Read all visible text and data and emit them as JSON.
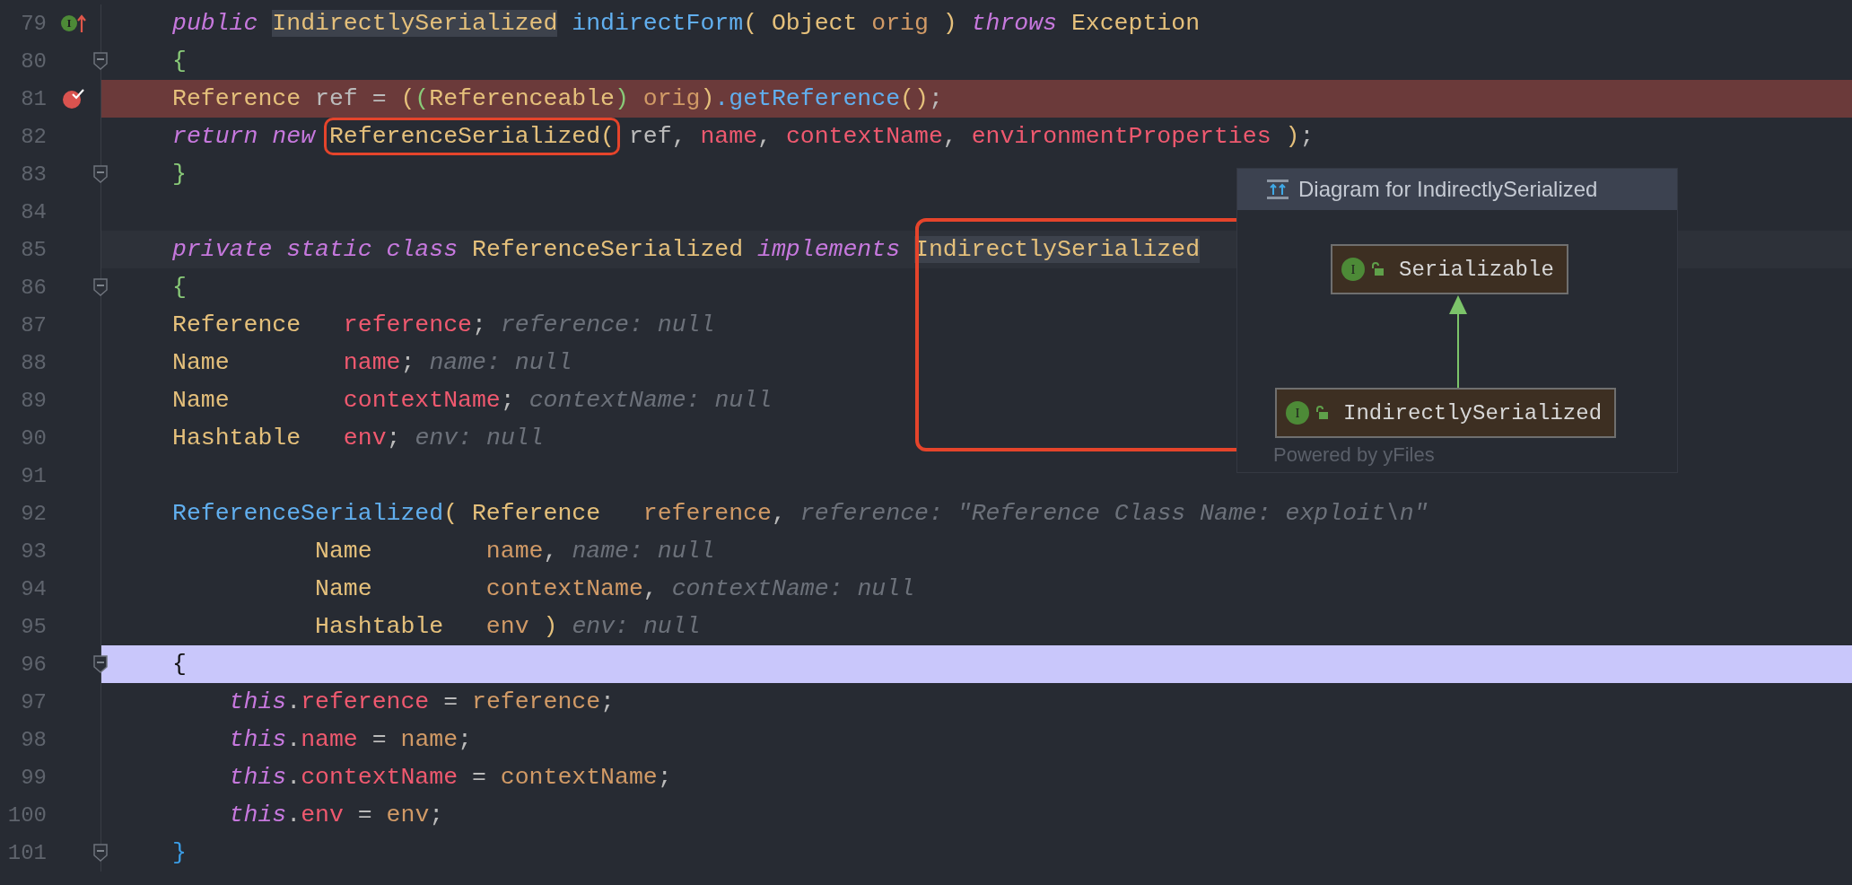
{
  "editor": {
    "lines": [
      {
        "number": "79",
        "gutter_icon": {
          "kind": "implemented",
          "letter": "I"
        },
        "fold": false,
        "kind": "normal",
        "code": [
          {
            "text": "public ",
            "kind": "keyword"
          },
          {
            "text": "IndirectlySerialized",
            "kind": "type",
            "usage": true
          },
          {
            "text": " indirectForm",
            "kind": "method"
          },
          {
            "text": "( Object ",
            "kind": "type"
          },
          {
            "text": "orig ",
            "kind": "param"
          },
          {
            "text": ") ",
            "kind": "type"
          },
          {
            "text": "throws ",
            "kind": "keyword"
          },
          {
            "text": "Exception",
            "kind": "type"
          }
        ]
      },
      {
        "number": "80",
        "fold": true,
        "kind": "normal",
        "code": [
          {
            "text": "{",
            "kind": "brace"
          }
        ]
      },
      {
        "number": "81",
        "gutter_icon": {
          "kind": "breakpoint"
        },
        "fold": false,
        "kind": "breakpoint",
        "code": [
          {
            "text": "Reference ",
            "kind": "type"
          },
          {
            "text": "ref = ",
            "kind": "plain"
          },
          {
            "text": "(",
            "kind": "type"
          },
          {
            "text": "(",
            "kind": "brace"
          },
          {
            "text": "Referenceable",
            "kind": "type"
          },
          {
            "text": ") ",
            "kind": "brace"
          },
          {
            "text": "orig",
            "kind": "param"
          },
          {
            "text": ")",
            "kind": "type"
          },
          {
            "text": ".getReference",
            "kind": "method"
          },
          {
            "text": "()",
            "kind": "type"
          },
          {
            "text": ";",
            "kind": "plain"
          }
        ]
      },
      {
        "number": "82",
        "fold": false,
        "kind": "normal",
        "code": [
          {
            "text": "return ",
            "kind": "keyword"
          },
          {
            "text": "new ",
            "kind": "keyword"
          },
          {
            "text": "ReferenceSerialized(",
            "kind": "type",
            "boxed": true
          },
          {
            "text": " ref, ",
            "kind": "plain"
          },
          {
            "text": "name",
            "kind": "field"
          },
          {
            "text": ", ",
            "kind": "plain"
          },
          {
            "text": "contextName",
            "kind": "field"
          },
          {
            "text": ", ",
            "kind": "plain"
          },
          {
            "text": "environmentProperties",
            "kind": "field"
          },
          {
            "text": " )",
            "kind": "type"
          },
          {
            "text": ";",
            "kind": "plain"
          }
        ]
      },
      {
        "number": "83",
        "fold": true,
        "kind": "normal",
        "code": [
          {
            "text": "}",
            "kind": "brace"
          }
        ]
      },
      {
        "number": "84",
        "fold": false,
        "kind": "normal"
      },
      {
        "number": "85",
        "fold": false,
        "kind": "current",
        "code": [
          {
            "text": "private ",
            "kind": "keyword"
          },
          {
            "text": "static ",
            "kind": "keyword"
          },
          {
            "text": "class ",
            "kind": "keyword"
          },
          {
            "text": "ReferenceSerialized ",
            "kind": "type"
          },
          {
            "text": "implements ",
            "kind": "keyword"
          },
          {
            "text": "IndirectlySerialized",
            "kind": "type",
            "usage": true
          }
        ]
      },
      {
        "number": "86",
        "fold": true,
        "kind": "normal",
        "code": [
          {
            "text": "{",
            "kind": "brace"
          }
        ]
      },
      {
        "number": "87",
        "fold": false,
        "kind": "normal",
        "code": [
          {
            "text": "Reference   ",
            "kind": "type"
          },
          {
            "text": "reference",
            "kind": "field"
          },
          {
            "text": ";",
            "kind": "plain"
          }
        ],
        "hint": "reference: null"
      },
      {
        "number": "88",
        "fold": false,
        "kind": "normal",
        "code": [
          {
            "text": "Name        ",
            "kind": "type"
          },
          {
            "text": "name",
            "kind": "field"
          },
          {
            "text": ";",
            "kind": "plain"
          }
        ],
        "hint": "name: null"
      },
      {
        "number": "89",
        "fold": false,
        "kind": "normal",
        "code": [
          {
            "text": "Name        ",
            "kind": "type"
          },
          {
            "text": "contextName",
            "kind": "field"
          },
          {
            "text": ";",
            "kind": "plain"
          }
        ],
        "hint": "contextName: null"
      },
      {
        "number": "90",
        "fold": false,
        "kind": "normal",
        "code": [
          {
            "text": "Hashtable   ",
            "kind": "type"
          },
          {
            "text": "env",
            "kind": "field"
          },
          {
            "text": ";",
            "kind": "plain"
          }
        ],
        "hint": "env: null"
      },
      {
        "number": "91",
        "fold": false,
        "kind": "normal"
      },
      {
        "number": "92",
        "fold": false,
        "kind": "normal",
        "code": [
          {
            "text": "ReferenceSerialized",
            "kind": "method"
          },
          {
            "text": "( Reference   ",
            "kind": "type"
          },
          {
            "text": "reference",
            "kind": "param"
          },
          {
            "text": ",",
            "kind": "plain"
          }
        ],
        "hint": "reference: \"Reference Class Name: exploit\\n\""
      },
      {
        "number": "93",
        "fold": false,
        "kind": "normal",
        "code": [
          {
            "text": "          Name        ",
            "kind": "type"
          },
          {
            "text": "name",
            "kind": "param"
          },
          {
            "text": ",",
            "kind": "plain"
          }
        ],
        "hint": "name: null"
      },
      {
        "number": "94",
        "fold": false,
        "kind": "normal",
        "code": [
          {
            "text": "          Name        ",
            "kind": "type"
          },
          {
            "text": "contextName",
            "kind": "param"
          },
          {
            "text": ",",
            "kind": "plain"
          }
        ],
        "hint": "contextName: null"
      },
      {
        "number": "95",
        "fold": false,
        "kind": "normal",
        "code": [
          {
            "text": "          Hashtable   ",
            "kind": "type"
          },
          {
            "text": "env ",
            "kind": "param"
          },
          {
            "text": ")",
            "kind": "type"
          }
        ],
        "hint": "env: null"
      },
      {
        "number": "96",
        "fold": true,
        "kind": "execution",
        "code": [
          {
            "text": "{",
            "kind": "plain"
          }
        ]
      },
      {
        "number": "97",
        "fold": false,
        "kind": "normal",
        "code": [
          {
            "text": "    this",
            "kind": "keyword"
          },
          {
            "text": ".",
            "kind": "plain"
          },
          {
            "text": "reference",
            "kind": "field"
          },
          {
            "text": " = ",
            "kind": "plain"
          },
          {
            "text": "reference",
            "kind": "param"
          },
          {
            "text": ";",
            "kind": "plain"
          }
        ]
      },
      {
        "number": "98",
        "fold": false,
        "kind": "normal",
        "code": [
          {
            "text": "    this",
            "kind": "keyword"
          },
          {
            "text": ".",
            "kind": "plain"
          },
          {
            "text": "name",
            "kind": "field"
          },
          {
            "text": " = ",
            "kind": "plain"
          },
          {
            "text": "name",
            "kind": "param"
          },
          {
            "text": ";",
            "kind": "plain"
          }
        ]
      },
      {
        "number": "99",
        "fold": false,
        "kind": "normal",
        "code": [
          {
            "text": "    this",
            "kind": "keyword"
          },
          {
            "text": ".",
            "kind": "plain"
          },
          {
            "text": "contextName",
            "kind": "field"
          },
          {
            "text": " = ",
            "kind": "plain"
          },
          {
            "text": "contextName",
            "kind": "param"
          },
          {
            "text": ";",
            "kind": "plain"
          }
        ]
      },
      {
        "number": "100",
        "fold": false,
        "kind": "normal",
        "code": [
          {
            "text": "    this",
            "kind": "keyword"
          },
          {
            "text": ".",
            "kind": "plain"
          },
          {
            "text": "env",
            "kind": "field"
          },
          {
            "text": " = ",
            "kind": "plain"
          },
          {
            "text": "env",
            "kind": "param"
          },
          {
            "text": ";",
            "kind": "plain"
          }
        ]
      },
      {
        "number": "101",
        "fold": true,
        "kind": "normal",
        "code": [
          {
            "text": "}",
            "kind": "brace2"
          }
        ]
      }
    ]
  },
  "diagram_popup": {
    "title": "Diagram for IndirectlySerialized",
    "annotated": true,
    "nodes": [
      {
        "name": "Serializable",
        "badge": "I",
        "kind": "interface"
      },
      {
        "name": "IndirectlySerialized",
        "badge": "I",
        "kind": "interface"
      }
    ],
    "footer": "Powered by yFiles"
  }
}
